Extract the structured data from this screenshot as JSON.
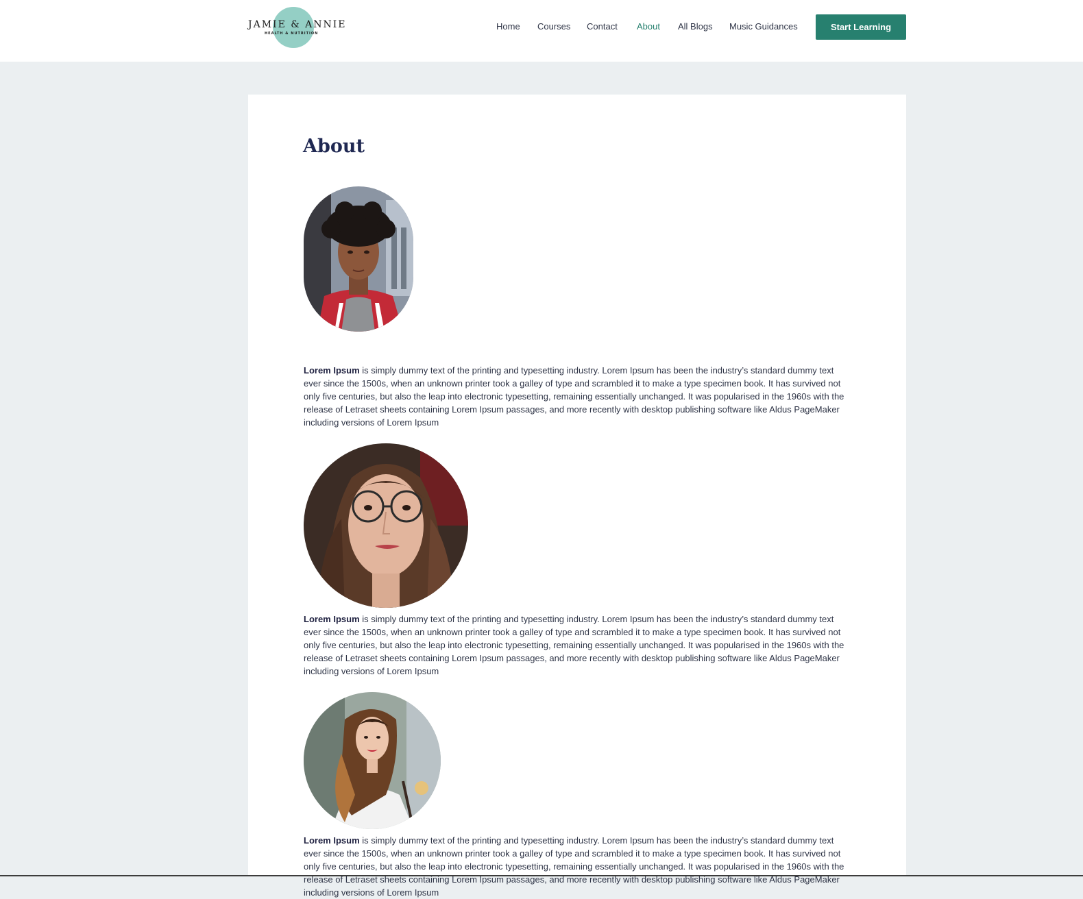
{
  "brand": {
    "logo_text": "JAMIE & ANNIE",
    "logo_subtext": "HEALTH & NUTRITION",
    "accent_color": "#27806f",
    "logo_color": "#94cfc5"
  },
  "nav": {
    "items": [
      {
        "label": "Home",
        "active": false
      },
      {
        "label": "Courses",
        "active": false
      },
      {
        "label": "Contact",
        "active": false
      },
      {
        "label": "About",
        "active": true
      },
      {
        "label": "All Blogs",
        "active": false
      },
      {
        "label": "Music Guidances",
        "active": false
      }
    ],
    "cta_label": "Start Learning"
  },
  "page": {
    "title": "About",
    "profiles": [
      {
        "photo": "portrait-young-man-curly-hair-red-jacket",
        "bold": "Lorem Ipsum",
        "text": " is simply dummy text of the printing and typesetting industry. Lorem Ipsum has been the industry’s standard dummy text ever since the 1500s, when an unknown printer took a galley of type and scrambled it to make a type specimen book. It has survived not only five centuries, but also the leap into electronic typesetting, remaining essentially unchanged. It was popularised in the 1960s with the release of Letraset sheets containing Lorem Ipsum passages, and more recently with desktop publishing software like Aldus PageMaker including versions of Lorem Ipsum"
      },
      {
        "photo": "portrait-woman-glasses-wavy-hair",
        "bold": "Lorem Ipsum",
        "text": " is simply dummy text of the printing and typesetting industry. Lorem Ipsum has been the industry’s standard dummy text ever since the 1500s, when an unknown printer took a galley of type and scrambled it to make a type specimen book. It has survived not only five centuries, but also the leap into electronic typesetting, remaining essentially unchanged. It was popularised in the 1960s with the release of Letraset sheets containing Lorem Ipsum passages, and more recently with desktop publishing software like Aldus PageMaker including versions of Lorem Ipsum"
      },
      {
        "photo": "portrait-woman-long-hair-white-shirt",
        "bold": "Lorem Ipsum",
        "text": " is simply dummy text of the printing and typesetting industry. Lorem Ipsum has been the industry’s standard dummy text ever since the 1500s, when an unknown printer took a galley of type and scrambled it to make a type specimen book. It has survived not only five centuries, but also the leap into electronic typesetting, remaining essentially unchanged. It was popularised in the 1960s with the release of Letraset sheets containing Lorem Ipsum passages, and more recently with desktop publishing software like Aldus PageMaker including versions of Lorem Ipsum"
      }
    ]
  }
}
